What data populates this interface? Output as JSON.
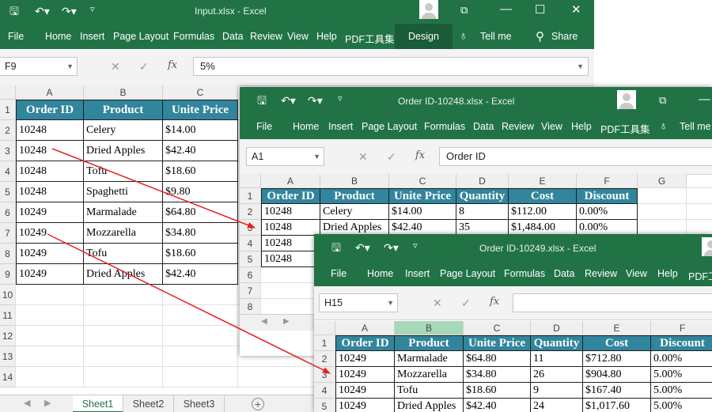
{
  "windows": {
    "input": {
      "title": "Input.xlsx  -  Excel",
      "tabs": [
        "File",
        "Home",
        "Insert",
        "Page Layout",
        "Formulas",
        "Data",
        "Review",
        "View",
        "Help",
        "PDF工具集",
        "Design"
      ],
      "tell_me": "Tell me",
      "share": "Share",
      "name_box": "F9",
      "formula": "5%",
      "columns": [
        "A",
        "B",
        "C"
      ],
      "rows": [
        "1",
        "2",
        "3",
        "4",
        "5",
        "6",
        "7",
        "8",
        "9",
        "10",
        "11",
        "12",
        "13",
        "14"
      ],
      "header": [
        "Order ID",
        "Product",
        "Unite Price"
      ],
      "data": [
        [
          "10248",
          "Celery",
          "$14.00"
        ],
        [
          "10248",
          "Dried Apples",
          "$42.40"
        ],
        [
          "10248",
          "Tofu",
          "$18.60"
        ],
        [
          "10248",
          "Spaghetti",
          "$9.80"
        ],
        [
          "10249",
          "Marmalade",
          "$64.80"
        ],
        [
          "10249",
          "Mozzarella",
          "$34.80"
        ],
        [
          "10249",
          "Tofu",
          "$18.60"
        ],
        [
          "10249",
          "Dried Apples",
          "$42.40"
        ]
      ],
      "sheets": [
        "Sheet1",
        "Sheet2",
        "Sheet3"
      ]
    },
    "order10248": {
      "title": "Order ID-10248.xlsx  -  Excel",
      "tabs": [
        "File",
        "Home",
        "Insert",
        "Page Layout",
        "Formulas",
        "Data",
        "Review",
        "View",
        "Help",
        "PDF工具集"
      ],
      "tell_me": "Tell me",
      "name_box": "A1",
      "formula": "Order ID",
      "columns": [
        "A",
        "B",
        "C",
        "D",
        "E",
        "F",
        "G"
      ],
      "rows": [
        "1",
        "2",
        "3",
        "4",
        "5",
        "6",
        "7",
        "8"
      ],
      "header": [
        "Order ID",
        "Product",
        "Unite Price",
        "Quantity",
        "Cost",
        "Discount"
      ],
      "data": [
        [
          "10248",
          "Celery",
          "$14.00",
          "8",
          "$112.00",
          "0.00%"
        ],
        [
          "10248",
          "Dried Apples",
          "$42.40",
          "35",
          "$1,484.00",
          "0.00%"
        ],
        [
          "10248",
          "",
          "",
          "",
          "",
          ""
        ],
        [
          "10248",
          "",
          "",
          "",
          "",
          ""
        ]
      ]
    },
    "order10249": {
      "title": "Order ID-10249.xlsx  -  Excel",
      "tabs": [
        "File",
        "Home",
        "Insert",
        "Page Layout",
        "Formulas",
        "Data",
        "Review",
        "View",
        "Help",
        "PDF工"
      ],
      "name_box": "H15",
      "formula": "",
      "columns": [
        "A",
        "B",
        "C",
        "D",
        "E",
        "F"
      ],
      "rows": [
        "1",
        "2",
        "3",
        "4",
        "5"
      ],
      "header": [
        "Order ID",
        "Product",
        "Unite Price",
        "Quantity",
        "Cost",
        "Discount"
      ],
      "data": [
        [
          "10249",
          "Marmalade",
          "$64.80",
          "11",
          "$712.80",
          "0.00%"
        ],
        [
          "10249",
          "Mozzarella",
          "$34.80",
          "26",
          "$904.80",
          "5.00%"
        ],
        [
          "10249",
          "Tofu",
          "$18.60",
          "9",
          "$167.40",
          "5.00%"
        ],
        [
          "10249",
          "Dried Apples",
          "$42.40",
          "24",
          "$1,017.60",
          "5.00%"
        ]
      ]
    }
  },
  "icons": {
    "save": "save-icon",
    "undo": "undo-icon",
    "redo": "redo-icon",
    "customize": "customize-icon",
    "cancel": "cancel-icon",
    "enter": "enter-icon",
    "function": "fx-icon",
    "tell_me": "lightbulb-icon",
    "share": "share-icon"
  },
  "colors": {
    "excel_green": "#217346",
    "table_header": "#31859c",
    "arrow": "#e82020"
  }
}
